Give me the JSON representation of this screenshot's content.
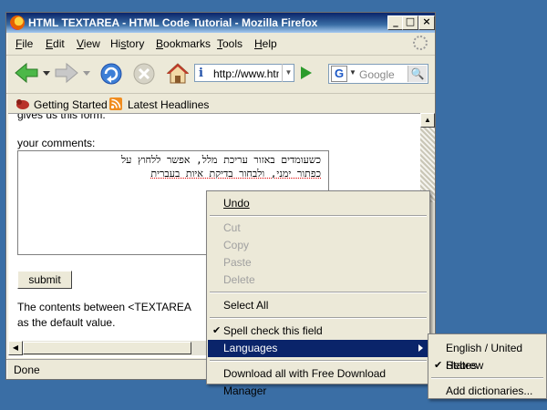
{
  "window": {
    "title": "HTML TEXTAREA - HTML Code Tutorial - Mozilla Firefox",
    "minimize": "_",
    "maximize": "□",
    "close": "×"
  },
  "menubar": {
    "items": [
      {
        "label_pre": "",
        "accel": "F",
        "label_post": "ile"
      },
      {
        "label_pre": "",
        "accel": "E",
        "label_post": "dit"
      },
      {
        "label_pre": "",
        "accel": "V",
        "label_post": "iew"
      },
      {
        "label_pre": "Hi",
        "accel": "s",
        "label_post": "tory"
      },
      {
        "label_pre": "",
        "accel": "B",
        "label_post": "ookmarks"
      },
      {
        "label_pre": "",
        "accel": "T",
        "label_post": "ools"
      },
      {
        "label_pre": "",
        "accel": "H",
        "label_post": "elp"
      }
    ]
  },
  "navbar": {
    "url": "http://www.htmlcodetutorial.com",
    "search_placeholder": "Google",
    "search_engine_icon": "G"
  },
  "bookmarks": {
    "items": [
      "Getting Started",
      "Latest Headlines"
    ]
  },
  "content": {
    "cut_text": "gives us this form:",
    "label": "your comments:",
    "textarea_line1": "כשעומדים באזור עריכת מלל, אפשר ללחוץ על",
    "textarea_line2_a": "כפתור ימני, ולבחור בדיקת איות ",
    "textarea_line2_b": "בעברית",
    "submit": "submit",
    "p1": "The contents between <TEXTAREA",
    "p2": "as the default value."
  },
  "status": {
    "text": "Done"
  },
  "context_menu": {
    "undo": "Undo",
    "cut": "Cut",
    "copy": "Copy",
    "paste": "Paste",
    "delete": "Delete",
    "select_all": "Select All",
    "spell_check": "Spell check this field",
    "languages": "Languages",
    "download": "Download all with Free Download Manager"
  },
  "languages_submenu": {
    "english": "English / United States",
    "hebrew": "Hebrew",
    "add_dictionaries": "Add dictionaries..."
  },
  "colors": {
    "menu_highlight": "#0a246a",
    "desktop": "#3a6ea5"
  }
}
